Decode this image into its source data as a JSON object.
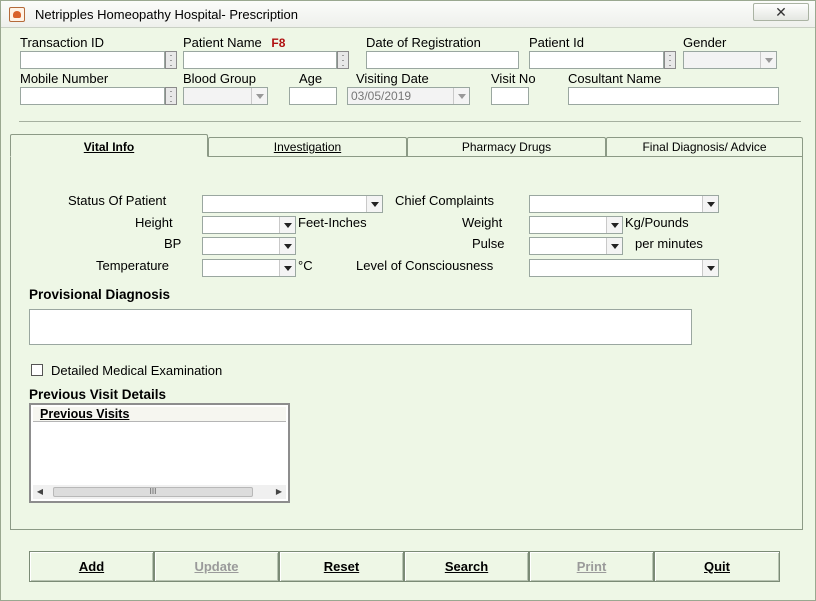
{
  "window": {
    "title": "Netripples Homeopathy Hospital- Prescription",
    "close_glyph": "✕"
  },
  "header": {
    "transaction_id_label": "Transaction ID",
    "patient_name_label": "Patient Name",
    "shortcut_hint": "F8",
    "date_of_registration_label": "Date of Registration",
    "patient_id_label": "Patient Id",
    "gender_label": "Gender",
    "mobile_number_label": "Mobile Number",
    "blood_group_label": "Blood Group",
    "age_label": "Age",
    "visiting_date_label": "Visiting Date",
    "visiting_date_value": "03/05/2019",
    "visit_no_label": "Visit No",
    "consultant_name_label": "Cosultant Name"
  },
  "tabs": [
    {
      "label": "Vital Info",
      "active": true
    },
    {
      "label": "Investigation",
      "active": false
    },
    {
      "label": "Pharmacy Drugs",
      "active": false
    },
    {
      "label": "Final Diagnosis/ Advice",
      "active": false
    }
  ],
  "vital": {
    "status_label": "Status Of Patient",
    "chief_complaints_label": "Chief Complaints",
    "height_label": "Height",
    "height_unit": "Feet-Inches",
    "weight_label": "Weight",
    "weight_unit": "Kg/Pounds",
    "bp_label": "BP",
    "pulse_label": "Pulse",
    "pulse_unit": "per minutes",
    "temperature_label": "Temperature",
    "temperature_unit": "°C",
    "consciousness_label": "Level of Consciousness"
  },
  "provisional_diagnosis_label": "Provisional Diagnosis",
  "detailed_exam_label": "Detailed Medical  Examination",
  "previous_visit_details_label": "Previous Visit Details",
  "previous_visits_header": "Previous Visits",
  "scroll": {
    "left": "◀",
    "right": "▶",
    "thumb": "III"
  },
  "buttons": [
    {
      "label": "Add",
      "enabled": true
    },
    {
      "label": "Update",
      "enabled": false
    },
    {
      "label": "Reset",
      "enabled": true
    },
    {
      "label": "Search",
      "enabled": true
    },
    {
      "label": "Print",
      "enabled": false
    },
    {
      "label": "Quit",
      "enabled": true
    }
  ]
}
